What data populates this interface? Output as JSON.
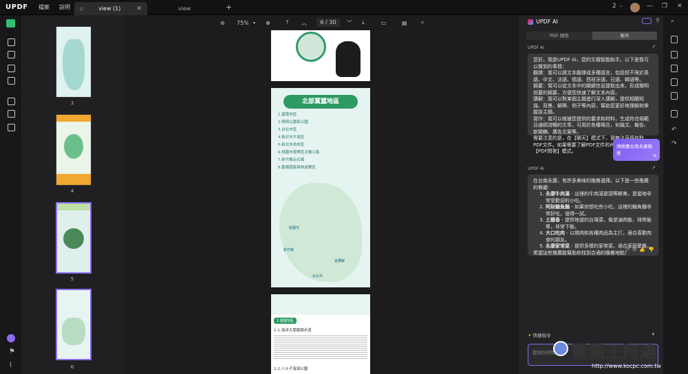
{
  "app": {
    "logo": "UPDF",
    "menu_file": "檔案",
    "menu_help": "說明"
  },
  "tabs": [
    {
      "label": "view (1)",
      "active": true
    },
    {
      "label": "view",
      "active": false
    }
  ],
  "topright": {
    "page_count": "2"
  },
  "viewer": {
    "zoom": "75%",
    "page_input": "6",
    "page_total": "/ 30"
  },
  "thumbnails": [
    {
      "num": "3"
    },
    {
      "num": "4"
    },
    {
      "num": "5"
    },
    {
      "num": "6"
    }
  ],
  "page_content": {
    "map_title": "北部賞蠶地區",
    "list": [
      "1.基隆地區",
      "2.陽明山國家公園",
      "3.台北市區",
      "4.新北市平溪區",
      "5.新北市烏來區",
      "6.桃園市復興區北橫公路",
      "7.新竹縣尖石鄉",
      "8.觀霧國家森林遊樂區"
    ],
    "map_labels": [
      "桃園市",
      "新竹縣",
      "宜蘭縣",
      "台北市"
    ],
    "page7_tag": "1.基隆地區",
    "page7_line1": "1-1.海洋大學龍崗步道",
    "page7_line2": "1-2.八斗子海濱公園"
  },
  "ai_panel": {
    "title": "UPDF AI",
    "tab_pdf": "PDF 問答",
    "tab_chat": "聊天",
    "label1": "UPDF AI",
    "message1": "您好，我是UPDF AI，您的文檔智能助手。以下是我可以做到的事情：\n翻譯：我可以將文本翻譯成多種語言，包括但不限於英語、中文、法語、德語、西班牙語、日語、韓語等。\n摘要：我可以從文本中的關鍵信息提取出來，形成簡明扼要的摘要，方便您快速了解文本內容。\n講解：我可以對某個主題進行深入講解，提供相關知識、背景、解釋、例子等內容，幫助您更好地理解和掌握該主題。\n寫作：我可以根據您提供的要求和材料，生成符合規範且通順流暢的文章，可用於各種場合，如論文、報告、新聞稿、廣告文案等。\n需要注意的是，在【聊天】模式下，我無法直接存取PDF文件。如果需要了解PDF文件的內容，請切換至【PDF問答】模式。",
    "user_message": "請推薦台南永康晚餐",
    "label2": "UPDF AI",
    "message2_intro": "在台南永康，有許多美味的晚餐選擇。以下是一些推薦的餐廳：",
    "items": [
      {
        "name": "永康牛肉湯",
        "desc": " - 這裡的牛肉湯是頭等鮮美，是當地非常受歡迎的小吃。"
      },
      {
        "name": "阿財鱔魚麵",
        "desc": " - 如果你想吃些小吃，這裡的鱔魚麵非常好吃，值得一試。"
      },
      {
        "name": "土雞香",
        "desc": " - 提供地道的台灣菜，像是滷肉飯、排骨飯等，非常下飯。"
      },
      {
        "name": "大口吃肉",
        "desc": " - 以燒肉和各種肉品為主打，適合喜歡肉食的朋友。"
      },
      {
        "name": "永康家常菜",
        "desc": " - 提供多樣的家常菜，適合家庭聚餐。"
      }
    ],
    "message2_outro": "希望這些推薦能幫助你找到合適的晚餐地點！",
    "quick_cmd": "快捷指令",
    "input_placeholder": "提問任何問題..."
  },
  "watermark": {
    "text": "電腦王阿達",
    "url": "http://www.kocpc.com.tw"
  },
  "colors": {
    "accent": "#7b5cf0",
    "logo_green": "#2fbf71"
  }
}
